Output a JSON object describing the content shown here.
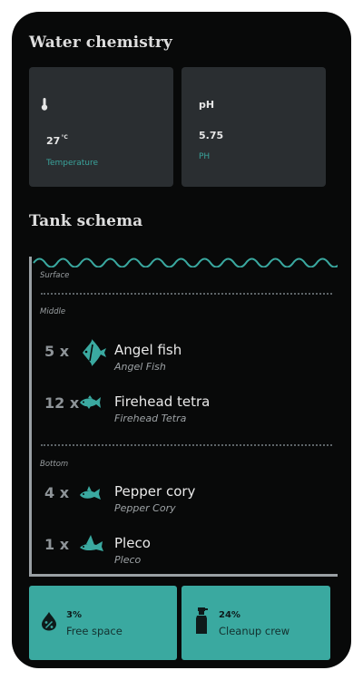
{
  "water_chemistry": {
    "title": "Water chemistry",
    "temperature": {
      "value": "27",
      "unit": "°C",
      "label": "Temperature",
      "icon": "thermometer-icon"
    },
    "ph": {
      "heading": "pH",
      "value": "5.75",
      "label": "PH"
    }
  },
  "tank_schema": {
    "title": "Tank schema",
    "zones": {
      "surface": "Surface",
      "middle": "Middle",
      "bottom": "Bottom"
    },
    "fish": [
      {
        "count": "5 x",
        "name": "Angel fish",
        "scientific": "Angel Fish",
        "icon": "angelfish-icon",
        "zone": "Middle"
      },
      {
        "count": "12 x",
        "name": "Firehead tetra",
        "scientific": "Firehead Tetra",
        "icon": "tetra-icon",
        "zone": "Middle"
      },
      {
        "count": "4 x",
        "name": "Pepper cory",
        "scientific": "Pepper Cory",
        "icon": "cory-icon",
        "zone": "Bottom"
      },
      {
        "count": "1 x",
        "name": "Pleco",
        "scientific": "Pleco",
        "icon": "pleco-icon",
        "zone": "Bottom"
      }
    ]
  },
  "summary": {
    "free_space": {
      "percent": "3%",
      "label": "Free space",
      "icon": "water-drop-percent-icon"
    },
    "cleanup_crew": {
      "percent": "24%",
      "label": "Cleanup crew",
      "icon": "spray-bottle-icon"
    }
  },
  "colors": {
    "accent": "#3aa9a0",
    "background": "#080909",
    "card": "#2a2e31"
  }
}
